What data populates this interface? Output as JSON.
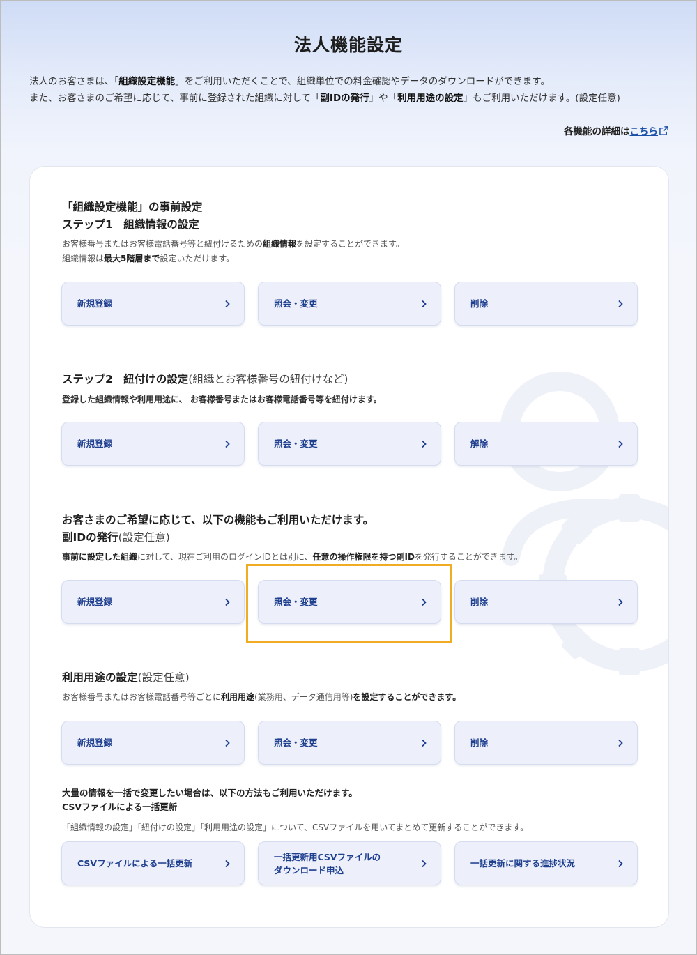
{
  "page": {
    "title": "法人機能設定",
    "intro": {
      "l1_pre": "法人のお客さまは、「",
      "l1_b": "組織設定機能",
      "l1_post": "」をご利用いただくことで、組織単位での料金確認やデータのダウンロードができます。",
      "l2_pre": "また、お客さまのご希望に応じて、事前に登録された組織に対して「",
      "l2_b1": "副IDの発行",
      "l2_mid": "」や「",
      "l2_b2": "利用用途の設定",
      "l2_post": "」もご利用いただけます。(設定任意)"
    },
    "detail_prefix": "各機能の詳細は",
    "detail_link": "こちら"
  },
  "sections": {
    "s1": {
      "pre": "「組織設定機能」の事前設定",
      "title": "ステップ1　組織情報の設定",
      "d1_pre": "お客様番号またはお客様電話番号等と紐付けるための",
      "d1_b": "組織情報",
      "d1_post": "を設定することができます。",
      "d2_pre": "組織情報は",
      "d2_b": "最大5階層まで",
      "d2_post": "設定いただけます。",
      "buttons": [
        "新規登録",
        "照会・変更",
        "削除"
      ]
    },
    "s2": {
      "title": "ステップ2　紐付けの設定",
      "title_light": "(組織とお客様番号の紐付けなど)",
      "desc": "登録した組織情報や利用用途に、 お客様番号またはお客様電話番号等を紐付けます。",
      "buttons": [
        "新規登録",
        "照会・変更",
        "解除"
      ]
    },
    "s3": {
      "pre": "お客さまのご希望に応じて、以下の機能もご利用いただけます。",
      "title": "副IDの発行",
      "title_light": "(設定任意)",
      "d_b1": "事前に設定した組織",
      "d_mid": "に対して、現在ご利用のログインIDとは別に、",
      "d_b2": "任意の操作権限を持つ副ID",
      "d_post": "を発行することができます。",
      "buttons": [
        "新規登録",
        "照会・変更",
        "削除"
      ]
    },
    "s4": {
      "title": "利用用途の設定",
      "title_light": "(設定任意)",
      "d_pre": "お客様番号またはお客様電話番号等ごとに",
      "d_b1": "利用用途",
      "d_mid": "(業務用、データ通信用等)",
      "d_b2": "を設定することができます。",
      "buttons": [
        "新規登録",
        "照会・変更",
        "削除"
      ]
    },
    "s5": {
      "pre": "大量の情報を一括で変更したい場合は、以下の方法もご利用いただけます。",
      "title": "CSVファイルによる一括更新",
      "desc": "「組織情報の設定」「紐付けの設定」「利用用途の設定」について、CSVファイルを用いてまとめて更新することができます。",
      "buttons": [
        "CSVファイルによる一括更新",
        "一括更新用CSVファイルの\nダウンロード申込",
        "一括更新に関する進捗状況"
      ]
    }
  },
  "colors": {
    "button_text": "#1f3f8f",
    "button_bg": "#edf0fb",
    "highlight": "#f0ad23",
    "link": "#1a4fa8"
  }
}
